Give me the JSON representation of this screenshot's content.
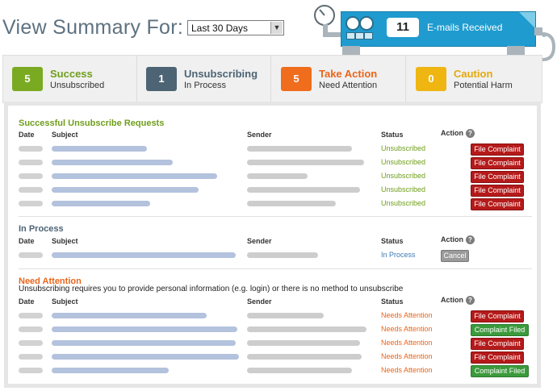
{
  "header": {
    "title": "View Summary For:",
    "period": "Last 30 Days"
  },
  "counter": {
    "count": "11",
    "label": "E-mails Received"
  },
  "tabs": [
    {
      "count": "5",
      "title": "Success",
      "subtitle": "Unsubscribed",
      "color": "#7aaa22"
    },
    {
      "count": "1",
      "title": "Unsubscribing",
      "subtitle": "In Process",
      "color": "#4d6474"
    },
    {
      "count": "5",
      "title": "Take Action",
      "subtitle": "Need Attention",
      "color": "#ef6d1d"
    },
    {
      "count": "0",
      "title": "Caution",
      "subtitle": "Potential Harm",
      "color": "#efb511"
    }
  ],
  "columns": {
    "date": "Date",
    "subject": "Subject",
    "sender": "Sender",
    "status": "Status",
    "action": "Action"
  },
  "sections": {
    "success": {
      "title": "Successful Unsubscribe Requests",
      "status": "Unsubscribed",
      "action": "File Complaint"
    },
    "process": {
      "title": "In Process",
      "status": "In Process",
      "action": "Cancel"
    },
    "attention": {
      "title": "Need Attention",
      "note": "Unsubscribing requires you to provide personal information (e.g. login) or there is no method to unsubscribe",
      "status": "Needs Attention",
      "action_complaint": "File Complaint",
      "action_filed": "Complaint Filed"
    }
  }
}
